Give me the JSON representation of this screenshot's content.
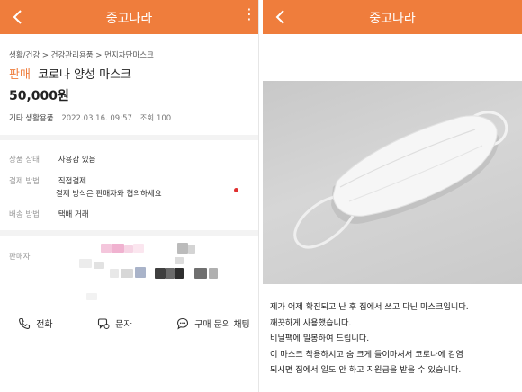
{
  "left": {
    "header": {
      "title": "중고나라"
    },
    "breadcrumb": "생활/건강 > 건강관리용품 > 먼지차단마스크",
    "item": {
      "sale_badge": "판매",
      "title": "코로나 양성 마스크",
      "price": "50,000원",
      "category": "기타 생활용품",
      "date": "2022.03.16. 09:57",
      "views": "조회 100"
    },
    "details": [
      {
        "label": "상품 상태",
        "value": "사용감 있음"
      },
      {
        "label": "결제 방법",
        "value": "직접결제",
        "sub": "결제 방식은 판매자와 협의하세요"
      },
      {
        "label": "배송 방법",
        "value": "택배 거래"
      }
    ],
    "seller_label": "판매자",
    "actions": {
      "call": "전화",
      "message": "문자",
      "chat": "구매 문의 채팅"
    }
  },
  "right": {
    "header": {
      "title": "중고나라"
    },
    "description": [
      "제가 어제 확진되고 난 후 집에서 쓰고 다닌 마스크입니다.",
      "깨끗하게 사용했습니다.",
      "비닐팩에 밀봉하여 드립니다.",
      "이 마스크 착용하시고 숨 크게 들이마셔서 코로나에 감염",
      "되시면 집에서 일도 안 하고 지원금을 받을 수 있습니다."
    ]
  },
  "colors": {
    "brand": "#ef7d3c",
    "alert_dot": "#e03030"
  },
  "icons": [
    "back-chevron-icon",
    "more-icon",
    "phone-icon",
    "message-icon",
    "chat-icon"
  ]
}
